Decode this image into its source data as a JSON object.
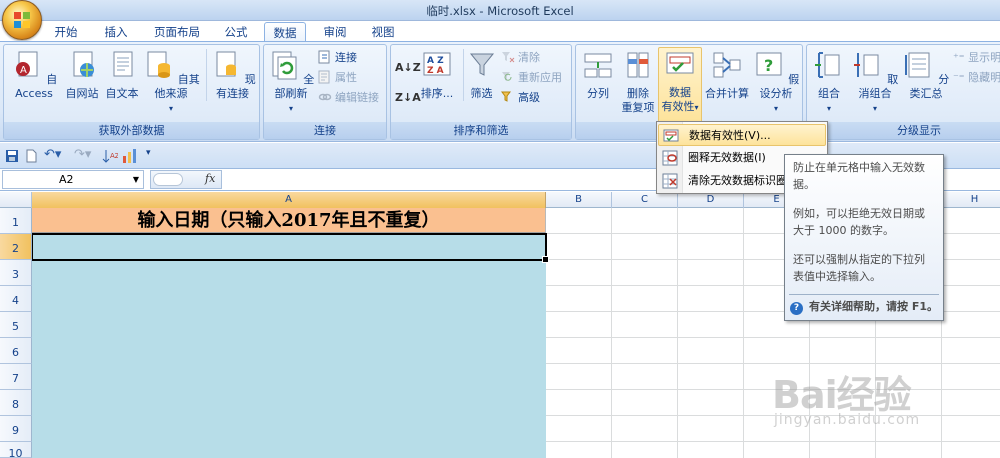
{
  "window": {
    "title": "临时.xlsx - Microsoft Excel"
  },
  "tabs": [
    {
      "label": "开始"
    },
    {
      "label": "插入"
    },
    {
      "label": "页面布局"
    },
    {
      "label": "公式"
    },
    {
      "label": "数据",
      "active": true
    },
    {
      "label": "审阅"
    },
    {
      "label": "视图"
    }
  ],
  "ribbon": {
    "groups": [
      {
        "label": "获取外部数据"
      },
      {
        "label": "连接"
      },
      {
        "label": "排序和筛选"
      },
      {
        "label": ""
      },
      {
        "label": "分级显示"
      }
    ],
    "from_access": "自 Access",
    "from_web": "自网站",
    "from_text": "自文本",
    "from_other": "自其他来源",
    "existing_conn": "现有连接",
    "refresh_all": "全部刷新",
    "connections": "连接",
    "properties": "属性",
    "edit_links": "编辑链接",
    "sort": "排序...",
    "filter": "筛选",
    "clear": "清除",
    "reapply": "重新应用",
    "advanced": "高级",
    "text_to_columns": "分列",
    "remove_dup_line1": "删除",
    "remove_dup_line2": "重复项",
    "data_validation_line1": "数据",
    "data_validation_line2": "有效性",
    "consolidate": "合并计算",
    "what_if": "假设分析",
    "group": "组合",
    "ungroup": "取消组合",
    "subtotal": "分类汇总",
    "show_detail": "显示明",
    "hide_detail": "隐藏明"
  },
  "formula_bar": {
    "name_box": "A2",
    "fx": "fx",
    "formula": ""
  },
  "sheet": {
    "columns": [
      "A",
      "B",
      "C",
      "D",
      "E",
      "F",
      "G",
      "H"
    ],
    "rows": [
      "1",
      "2",
      "3",
      "4",
      "5",
      "6",
      "7",
      "8",
      "9",
      "10"
    ],
    "a1": "输入日期（只输入2017年且不重复）",
    "active_cell": "A2"
  },
  "dropdown_menu": {
    "items": [
      {
        "label": "数据有效性(V)..."
      },
      {
        "label": "圈释无效数据(I)"
      },
      {
        "label": "清除无效数据标识圈"
      }
    ]
  },
  "tooltip": {
    "p1": "防止在单元格中输入无效数据。",
    "p2": "例如，可以拒绝无效日期或大于 1000 的数字。",
    "p3": "还可以强制从指定的下拉列表值中选择输入。",
    "help": "有关详细帮助，请按 F1。"
  },
  "watermark": {
    "brand": "Bai经验",
    "url": "jingyan.baidu.com"
  }
}
